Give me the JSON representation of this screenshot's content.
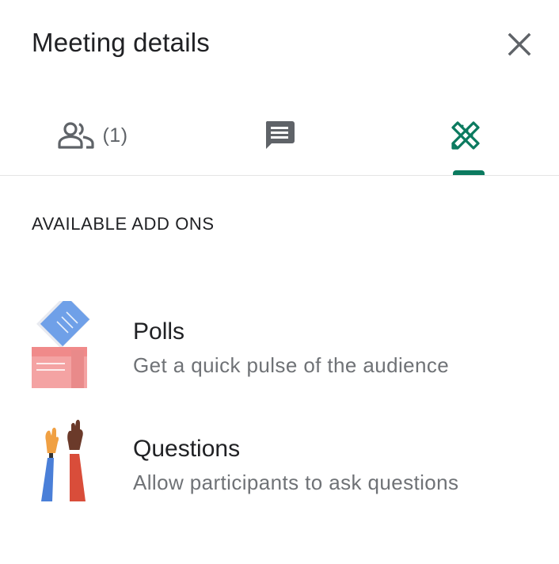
{
  "header": {
    "title": "Meeting details",
    "close_icon": "close-icon"
  },
  "tabs": [
    {
      "name": "people",
      "icon": "people-icon",
      "count": "(1)",
      "selected": false
    },
    {
      "name": "chat",
      "icon": "chat-icon",
      "selected": false
    },
    {
      "name": "add-ons",
      "icon": "add-ons-icon",
      "selected": true
    }
  ],
  "section": {
    "label": "AVAILABLE ADD ONS"
  },
  "addons": [
    {
      "title": "Polls",
      "description": "Get a quick pulse of the audience",
      "icon": "polls-illustration"
    },
    {
      "title": "Questions",
      "description": "Allow participants to ask questions",
      "icon": "raised-hands-illustration"
    }
  ],
  "colors": {
    "accent": "#0b7a5f",
    "icon_gray": "#5f6368",
    "text_primary": "#202124",
    "text_secondary": "#6f7276"
  }
}
